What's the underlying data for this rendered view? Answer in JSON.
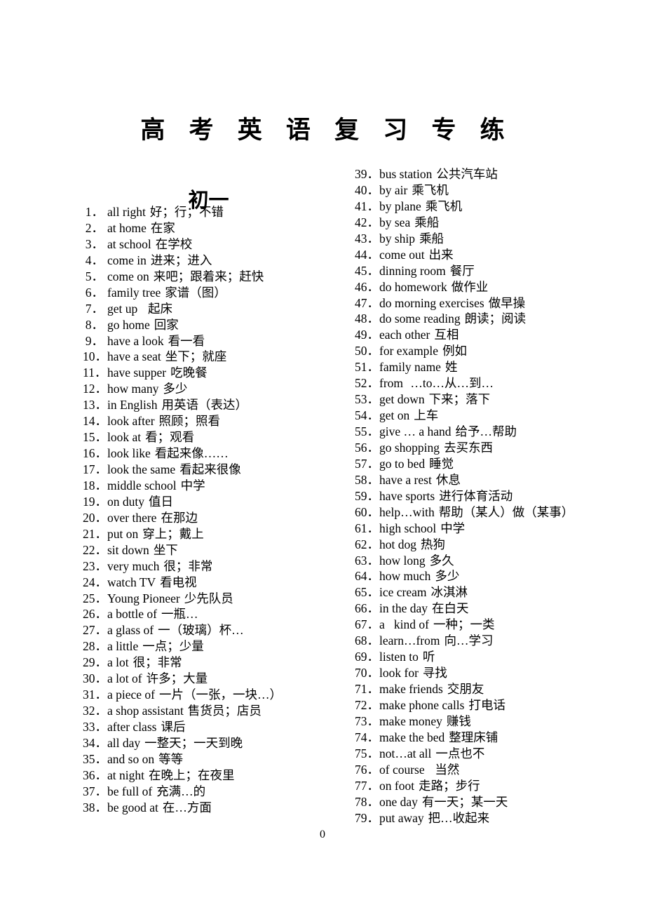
{
  "document": {
    "title": "高 考 英 语 复 习 专 练",
    "page_number": "0"
  },
  "section": {
    "subtitle": "初一"
  },
  "columns": {
    "left": [
      {
        "num": "1．",
        "term": "all right",
        "gloss": "好；行；不错"
      },
      {
        "num": "2．",
        "term": "at home",
        "gloss": "在家"
      },
      {
        "num": "3．",
        "term": "at school",
        "gloss": "在学校"
      },
      {
        "num": "4．",
        "term": "come in",
        "gloss": "进来；进入"
      },
      {
        "num": "5．",
        "term": "come on",
        "gloss": "来吧；跟着来；赶快"
      },
      {
        "num": "6．",
        "term": "family tree",
        "gloss": "家谱（图）"
      },
      {
        "num": "7．",
        "term": "get up",
        "gloss": "  起床"
      },
      {
        "num": "8．",
        "term": "go home",
        "gloss": "回家"
      },
      {
        "num": "9．",
        "term": "have a look",
        "gloss": "看一看"
      },
      {
        "num": "10．",
        "term": "have a seat",
        "gloss": "坐下；就座"
      },
      {
        "num": "11．",
        "term": "have supper",
        "gloss": "吃晚餐"
      },
      {
        "num": "12．",
        "term": "how many",
        "gloss": "多少"
      },
      {
        "num": "13．",
        "term": "in English",
        "gloss": "用英语（表达）"
      },
      {
        "num": "14．",
        "term": "look after",
        "gloss": "照顾；照看"
      },
      {
        "num": "15．",
        "term": "look at",
        "gloss": "看；观看"
      },
      {
        "num": "16．",
        "term": "look like",
        "gloss": "看起来像……"
      },
      {
        "num": "17．",
        "term": "look the same",
        "gloss": "看起来很像"
      },
      {
        "num": "18．",
        "term": "middle school",
        "gloss": "中学"
      },
      {
        "num": "19．",
        "term": "on duty",
        "gloss": "值日"
      },
      {
        "num": "20．",
        "term": "over there",
        "gloss": "在那边"
      },
      {
        "num": "21．",
        "term": "put on",
        "gloss": "穿上；戴上"
      },
      {
        "num": "22．",
        "term": "sit down",
        "gloss": "坐下"
      },
      {
        "num": "23．",
        "term": "very much",
        "gloss": "很；非常"
      },
      {
        "num": "24．",
        "term": "watch TV",
        "gloss": "看电视"
      },
      {
        "num": "25．",
        "term": "Young Pioneer",
        "gloss": "少先队员"
      },
      {
        "num": "26．",
        "term": "a bottle of",
        "gloss": "一瓶…"
      },
      {
        "num": "27．",
        "term": "a glass of",
        "gloss": "一（玻璃）杯…"
      },
      {
        "num": "28．",
        "term": "a little",
        "gloss": "一点；少量"
      },
      {
        "num": "29．",
        "term": "a lot",
        "gloss": "很；非常"
      },
      {
        "num": "30．",
        "term": "a lot of",
        "gloss": "许多；大量"
      },
      {
        "num": "31．",
        "term": "a piece of",
        "gloss": "一片（一张，一块…）"
      },
      {
        "num": "32．",
        "term": "a shop assistant",
        "gloss": "售货员；店员"
      },
      {
        "num": "33．",
        "term": "after class",
        "gloss": "课后"
      },
      {
        "num": "34．",
        "term": "all day",
        "gloss": "一整天；一天到晚"
      },
      {
        "num": "35．",
        "term": "and so on",
        "gloss": "等等"
      },
      {
        "num": "36．",
        "term": "at night",
        "gloss": "在晚上；在夜里"
      },
      {
        "num": "37．",
        "term": "be full of",
        "gloss": "充满…的"
      },
      {
        "num": "38．",
        "term": "be good at",
        "gloss": "在…方面"
      }
    ],
    "right": [
      {
        "num": "39．",
        "term": "bus station",
        "gloss": "公共汽车站"
      },
      {
        "num": "40．",
        "term": "by air",
        "gloss": "乘飞机"
      },
      {
        "num": "41．",
        "term": "by plane",
        "gloss": "乘飞机"
      },
      {
        "num": "42．",
        "term": "by sea",
        "gloss": "乘船"
      },
      {
        "num": "43．",
        "term": "by ship",
        "gloss": "乘船"
      },
      {
        "num": "44．",
        "term": "come out",
        "gloss": "出来"
      },
      {
        "num": "45．",
        "term": "dinning room",
        "gloss": "餐厅"
      },
      {
        "num": "46．",
        "term": "do homework",
        "gloss": "做作业"
      },
      {
        "num": "47．",
        "term": "do morning exercises",
        "gloss": "做早操"
      },
      {
        "num": "48．",
        "term": "do some reading",
        "gloss": "朗读；阅读"
      },
      {
        "num": "49．",
        "term": "each other",
        "gloss": "互相"
      },
      {
        "num": "50．",
        "term": "for example",
        "gloss": "例如"
      },
      {
        "num": "51．",
        "term": "family name",
        "gloss": "姓"
      },
      {
        "num": "52．",
        "term": "from",
        "gloss": " …to…从…到…"
      },
      {
        "num": "53．",
        "term": "get down",
        "gloss": "下来；落下"
      },
      {
        "num": "54．",
        "term": "get on",
        "gloss": "上车"
      },
      {
        "num": "55．",
        "term": "give … a hand",
        "gloss": "给予…帮助"
      },
      {
        "num": "56．",
        "term": "go shopping",
        "gloss": "去买东西"
      },
      {
        "num": "57．",
        "term": "go to bed",
        "gloss": "睡觉"
      },
      {
        "num": "58．",
        "term": "have a rest",
        "gloss": "休息"
      },
      {
        "num": "59．",
        "term": "have sports",
        "gloss": "进行体育活动"
      },
      {
        "num": "60．",
        "term": "help…with",
        "gloss": "帮助（某人）做（某事）"
      },
      {
        "num": "61．",
        "term": "high school",
        "gloss": "中学"
      },
      {
        "num": "62．",
        "term": "hot dog",
        "gloss": "热狗"
      },
      {
        "num": "63．",
        "term": "how long",
        "gloss": "多久"
      },
      {
        "num": "64．",
        "term": "how much",
        "gloss": "多少"
      },
      {
        "num": "65．",
        "term": "ice cream",
        "gloss": "冰淇淋"
      },
      {
        "num": "66．",
        "term": "in the day",
        "gloss": "在白天"
      },
      {
        "num": "67．",
        "term": "a   kind of",
        "gloss": "一种；一类"
      },
      {
        "num": "68．",
        "term": "learn…from",
        "gloss": "向…学习"
      },
      {
        "num": "69．",
        "term": "listen to",
        "gloss": "听"
      },
      {
        "num": "70．",
        "term": "look for",
        "gloss": "寻找"
      },
      {
        "num": "71．",
        "term": "make friends",
        "gloss": "交朋友"
      },
      {
        "num": "72．",
        "term": "make phone calls",
        "gloss": "打电话"
      },
      {
        "num": "73．",
        "term": "make money",
        "gloss": "赚钱"
      },
      {
        "num": "74．",
        "term": "make the bed",
        "gloss": "整理床铺"
      },
      {
        "num": "75．",
        "term": "not…at all",
        "gloss": "一点也不"
      },
      {
        "num": "76．",
        "term": "of course",
        "gloss": "  当然"
      },
      {
        "num": "77．",
        "term": "on foot",
        "gloss": "走路；步行"
      },
      {
        "num": "78．",
        "term": "one day",
        "gloss": "有一天；某一天"
      },
      {
        "num": "79．",
        "term": "put away",
        "gloss": "把…收起来"
      }
    ]
  }
}
